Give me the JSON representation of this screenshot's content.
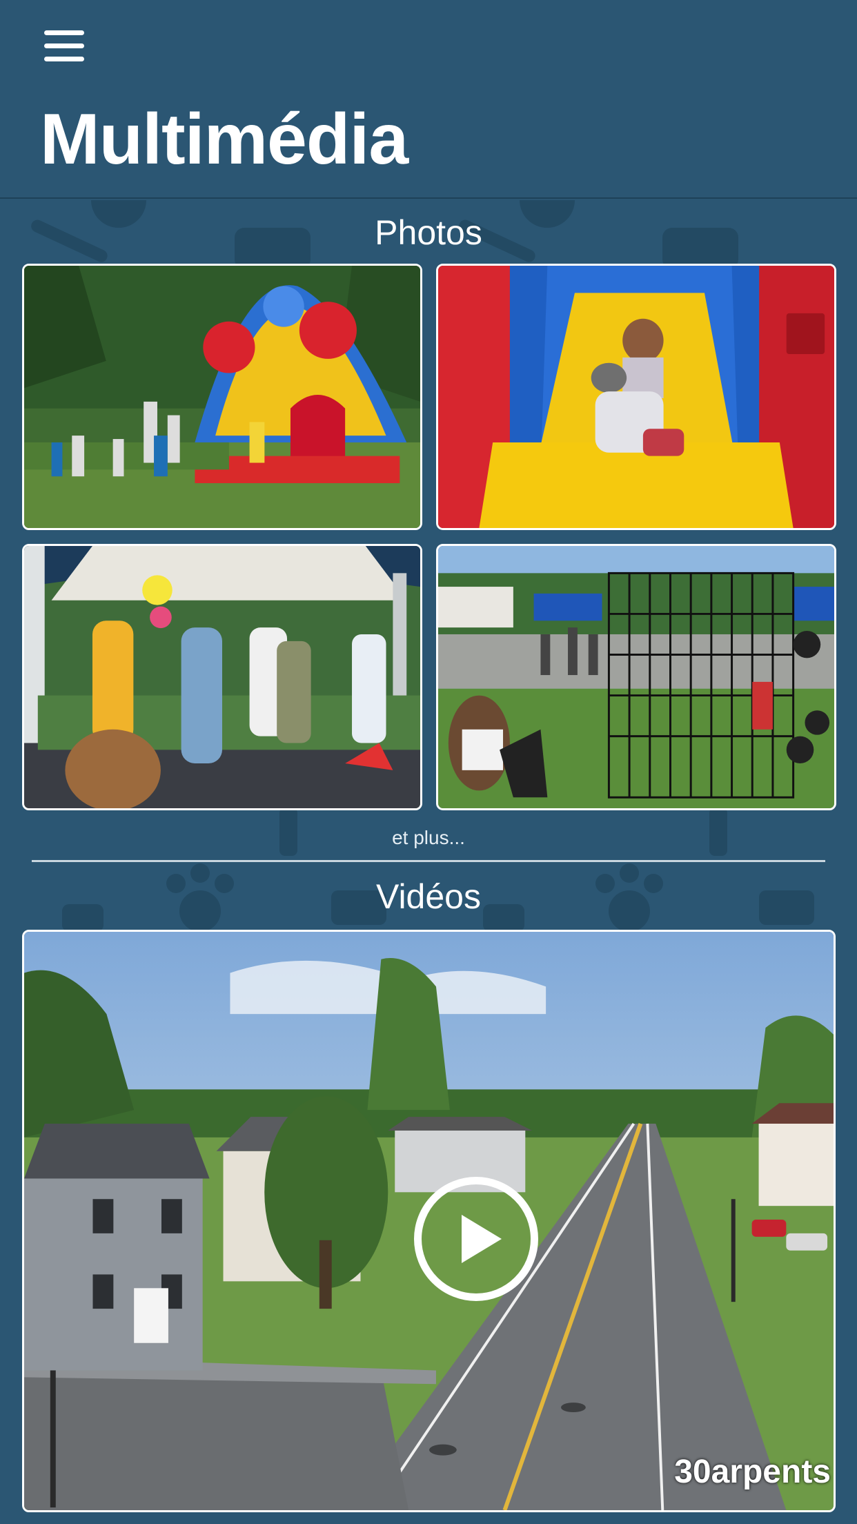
{
  "header": {
    "menu_icon": "hamburger-menu-icon",
    "title": "Multimédia"
  },
  "photos": {
    "title": "Photos",
    "items": [
      {
        "description": "inflatable-welcome-bouncer"
      },
      {
        "description": "child-on-inflatable-slide"
      },
      {
        "description": "children-dancing-under-tent"
      },
      {
        "description": "dunk-tank-cage"
      }
    ],
    "more_label": "et plus..."
  },
  "videos": {
    "title": "Vidéos",
    "items": [
      {
        "play_icon": "play-circle-icon",
        "watermark": "30arpents"
      }
    ]
  },
  "colors": {
    "background": "#2b5673",
    "text": "#ffffff"
  }
}
